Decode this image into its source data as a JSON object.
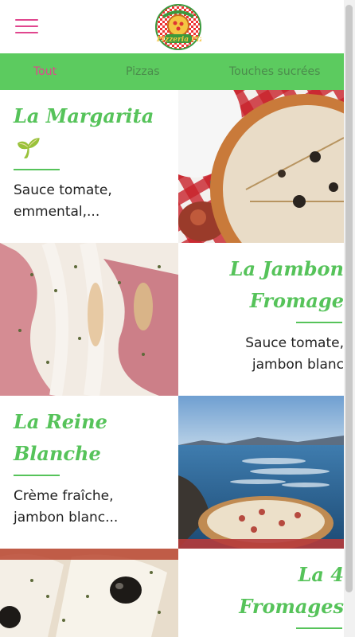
{
  "header": {
    "menu_icon": "hamburger-menu-icon",
    "logo_text": "La Pizzeria Pizza",
    "colors": {
      "accent": "#e0468e",
      "brand_green": "#5ccb5f"
    }
  },
  "nav": {
    "tabs": [
      {
        "label": "Tout",
        "active": true
      },
      {
        "label": "Pizzas",
        "active": false
      },
      {
        "label": "Touches sucrées",
        "active": false
      }
    ]
  },
  "menu": {
    "items": [
      {
        "name": "La Margarita",
        "badge": "🌱",
        "description_line1": "Sauce tomate,",
        "description_line2": "emmental,..."
      },
      {
        "name_line1": "La Jambon",
        "name_line2": "Fromage",
        "description_line1": "Sauce tomate,",
        "description_line2": "jambon blanc"
      },
      {
        "name_line1": "La Reine",
        "name_line2": "Blanche",
        "description_line1": "Crème fraîche,",
        "description_line2": "jambon blanc..."
      },
      {
        "name_line1": "La 4",
        "name_line2": "Fromages"
      }
    ]
  }
}
